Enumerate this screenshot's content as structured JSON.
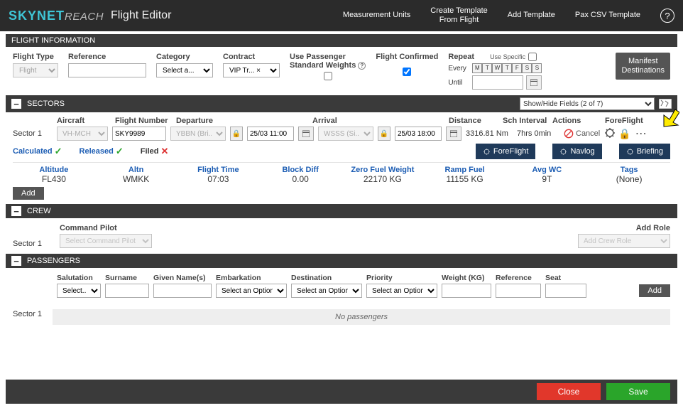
{
  "logo": {
    "sky": "SKY",
    "net": "NET",
    "reach": "REACH"
  },
  "page_title": "Flight Editor",
  "top_links": {
    "measurement_units": "Measurement Units",
    "create_template": "Create Template\nFrom Flight",
    "add_template": "Add Template",
    "pax_csv": "Pax CSV Template",
    "help": "?"
  },
  "flight_info": {
    "header": "FLIGHT INFORMATION",
    "flight_type": {
      "label": "Flight Type",
      "value": "Flight"
    },
    "reference": {
      "label": "Reference",
      "value": ""
    },
    "category": {
      "label": "Category",
      "value": "Select a..."
    },
    "contract": {
      "label": "Contract",
      "value": "VIP Tr... ×"
    },
    "use_pax_std": {
      "line1": "Use Passenger",
      "line2": "Standard Weights"
    },
    "flight_confirmed": {
      "label": "Flight Confirmed",
      "checked": true
    },
    "repeat": {
      "label": "Repeat",
      "use_specific": "Use Specific",
      "every": "Every",
      "until": "Until",
      "days": [
        "M",
        "T",
        "W",
        "T",
        "F",
        "S",
        "S"
      ]
    },
    "manifest_btn": "Manifest\nDestinations"
  },
  "sectors": {
    "header": "SECTORS",
    "show_hide": "Show/Hide Fields (2 of 7)",
    "cols": {
      "aircraft": "Aircraft",
      "flight_number": "Flight Number",
      "departure": "Departure",
      "arrival": "Arrival",
      "distance": "Distance",
      "sch_interval": "Sch Interval",
      "actions": "Actions",
      "foreflight": "ForeFlight"
    },
    "row": {
      "label": "Sector 1",
      "aircraft": "VH-MCH",
      "flight_number": "SKY9989",
      "dep_airport": "YBBN (Bri...",
      "dep_time": "25/03 11:00",
      "arr_airport": "WSSS (Si...",
      "arr_time": "25/03 18:00",
      "distance": "3316.81 Nm",
      "sch_interval": "7hrs 0min",
      "cancel": "Cancel"
    },
    "status": {
      "calculated": "Calculated",
      "released": "Released",
      "filed": "Filed",
      "foreflight": "ForeFlight",
      "navlog": "Navlog",
      "briefing": "Briefing"
    },
    "metrics": {
      "altitude": {
        "label": "Altitude",
        "value": "FL430"
      },
      "altn": {
        "label": "Altn",
        "value": "WMKK"
      },
      "flight_time": {
        "label": "Flight Time",
        "value": "07:03"
      },
      "block_diff": {
        "label": "Block Diff",
        "value": "0.00"
      },
      "zfw": {
        "label": "Zero Fuel Weight",
        "value": "22170 KG"
      },
      "ramp_fuel": {
        "label": "Ramp Fuel",
        "value": "11155 KG"
      },
      "avg_wc": {
        "label": "Avg WC",
        "value": "9T"
      },
      "tags": {
        "label": "Tags",
        "value": "(None)"
      }
    },
    "add": "Add"
  },
  "crew": {
    "header": "CREW",
    "command_pilot": {
      "label": "Command Pilot",
      "placeholder": "Select Command Pilot"
    },
    "add_role": {
      "label": "Add Role",
      "placeholder": "Add Crew Role"
    },
    "sector_label": "Sector 1"
  },
  "passengers": {
    "header": "PASSENGERS",
    "cols": {
      "salutation": "Salutation",
      "surname": "Surname",
      "given": "Given Name(s)",
      "embarkation": "Embarkation",
      "destination": "Destination",
      "priority": "Priority",
      "weight": "Weight (KG)",
      "reference": "Reference",
      "seat": "Seat"
    },
    "select_ph": "Select...",
    "select_opt": "Select an Option",
    "add": "Add",
    "sector_label": "Sector 1",
    "none": "No passengers"
  },
  "footer": {
    "close": "Close",
    "save": "Save"
  }
}
